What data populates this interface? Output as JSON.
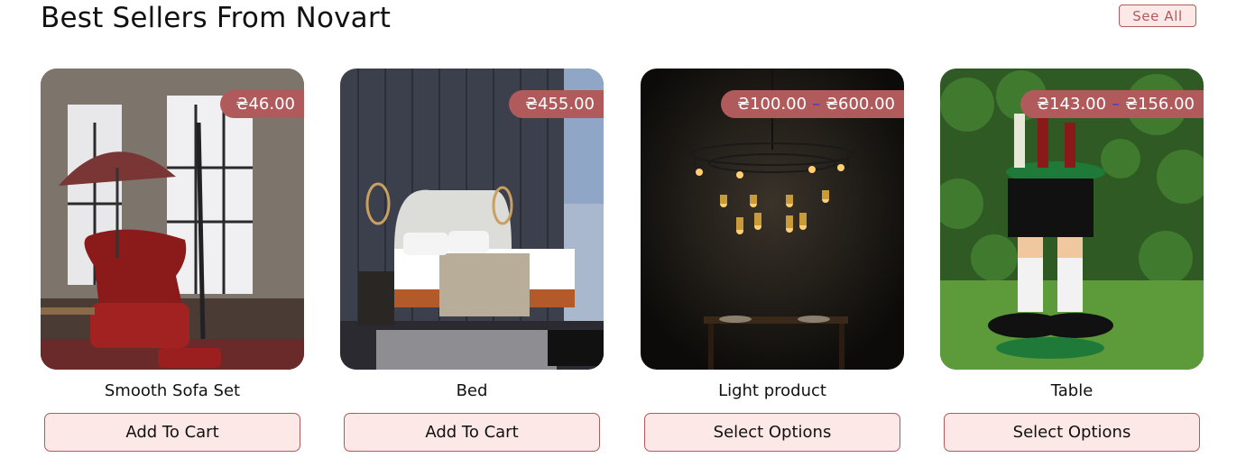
{
  "section": {
    "title": "Best Sellers From Novart",
    "see_all_label": "See All"
  },
  "products": [
    {
      "name": "Smooth Sofa Set",
      "price": "₴46.00",
      "price_max": "",
      "button": "Add To Cart",
      "image_icon": "sofa-scene-image"
    },
    {
      "name": "Bed",
      "price": "₴455.00",
      "price_max": "",
      "button": "Add To Cart",
      "image_icon": "bed-scene-image"
    },
    {
      "name": "Light product",
      "price": "₴100.00",
      "price_max": "₴600.00",
      "button": "Select Options",
      "image_icon": "chandelier-scene-image"
    },
    {
      "name": "Table",
      "price": "₴143.00",
      "price_max": "₴156.00",
      "button": "Select Options",
      "image_icon": "table-scene-image"
    }
  ],
  "colors": {
    "accent": "#b05a5c",
    "button_bg": "#fde8e8"
  }
}
